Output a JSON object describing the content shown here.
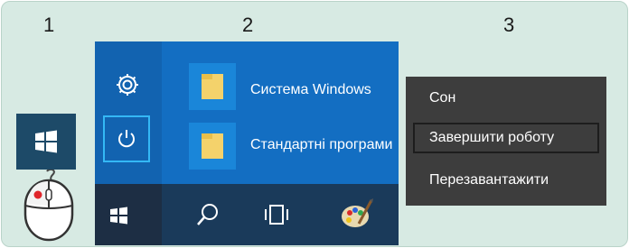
{
  "steps": [
    "1",
    "2",
    "3"
  ],
  "start_menu": {
    "items": [
      {
        "label": "Система Windows",
        "icon": "folder-icon"
      },
      {
        "label": "Стандартні програми",
        "icon": "folder-icon"
      }
    ],
    "side_icons": [
      "gear-icon",
      "power-icon"
    ],
    "taskbar_icons": [
      "windows-logo-icon",
      "search-icon",
      "task-view-icon",
      "paint-icon"
    ]
  },
  "power_menu": {
    "items": [
      {
        "label": "Сон"
      },
      {
        "label": "Завершити роботу",
        "highlighted": true
      },
      {
        "label": "Перезавантажити"
      }
    ]
  },
  "colors": {
    "panel_bg": "#d7eae3",
    "start_menu_bg": "#136ec2",
    "taskbar_bg": "#1a3a5a",
    "power_menu_bg": "#3d3d3d",
    "highlight_border": "#34b8f5",
    "mouse_button": "#e0252b"
  }
}
